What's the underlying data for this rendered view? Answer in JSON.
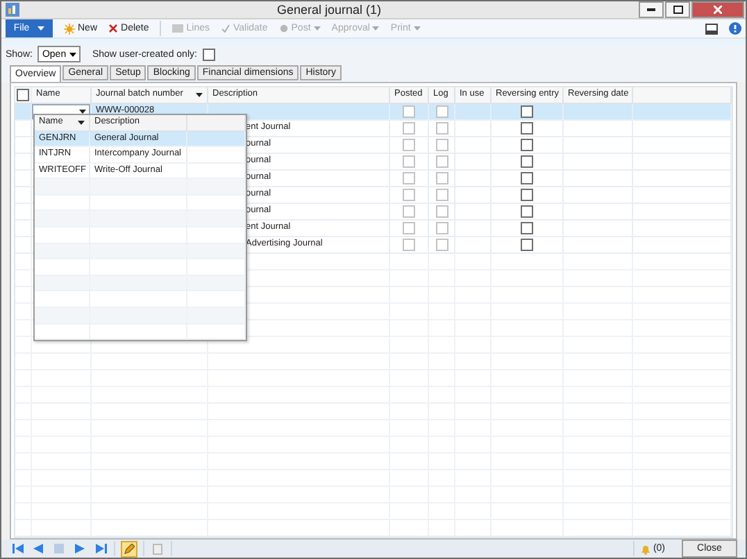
{
  "window": {
    "title": "General journal (1)"
  },
  "toolbar": {
    "file": "File",
    "buttons": [
      {
        "kind": "new",
        "label": "New",
        "disabled": false
      },
      {
        "kind": "delete",
        "label": "Delete",
        "disabled": false
      },
      {
        "kind": "lines",
        "label": "Lines",
        "disabled": true
      },
      {
        "kind": "validate",
        "label": "Validate",
        "disabled": true
      },
      {
        "kind": "post",
        "label": "Post",
        "disabled": true,
        "menu": true
      },
      {
        "kind": "approval",
        "label": "Approval",
        "disabled": true,
        "menu": true
      },
      {
        "kind": "print",
        "label": "Print",
        "disabled": true,
        "menu": true
      }
    ]
  },
  "filter": {
    "show_label": "Show:",
    "show_value": "Open",
    "user_created_label": "Show user-created only:",
    "user_created_checked": false
  },
  "tabs": [
    {
      "label": "Overview",
      "selected": true
    },
    {
      "label": "General",
      "selected": false
    },
    {
      "label": "Setup",
      "selected": false
    },
    {
      "label": "Blocking",
      "selected": false
    },
    {
      "label": "Financial dimensions",
      "selected": false
    },
    {
      "label": "History",
      "selected": false
    }
  ],
  "grid": {
    "select_all_checked": false,
    "columns": [
      "Name",
      "Journal batch number",
      "Description",
      "Posted",
      "Log",
      "In use",
      "Reversing entry",
      "Reversing date"
    ],
    "rows": [
      {
        "selected": true,
        "batch": "WWW-000028",
        "description": "",
        "posted": false,
        "log": false,
        "reversing_entry": false
      },
      {
        "selected": false,
        "description": "ent Journal",
        "posted": false,
        "log": false,
        "reversing_entry": false
      },
      {
        "selected": false,
        "description": "ournal",
        "posted": false,
        "log": false,
        "reversing_entry": false
      },
      {
        "selected": false,
        "description": "ournal",
        "posted": false,
        "log": false,
        "reversing_entry": false
      },
      {
        "selected": false,
        "description": "ournal",
        "posted": false,
        "log": false,
        "reversing_entry": false
      },
      {
        "selected": false,
        "description": "ournal",
        "posted": false,
        "log": false,
        "reversing_entry": false
      },
      {
        "selected": false,
        "description": "ournal",
        "posted": false,
        "log": false,
        "reversing_entry": false
      },
      {
        "selected": false,
        "description": "ent Journal",
        "posted": false,
        "log": false,
        "reversing_entry": false
      },
      {
        "selected": false,
        "description": "Advertising  Journal",
        "posted": false,
        "log": false,
        "reversing_entry": false
      }
    ]
  },
  "lookup": {
    "columns": [
      "Name",
      "Description"
    ],
    "rows": [
      {
        "name": "GENJRN",
        "description": "General Journal",
        "selected": true
      },
      {
        "name": "INTJRN",
        "description": "Intercompany Journal",
        "selected": false
      },
      {
        "name": "WRITEOFF",
        "description": "Write-Off Journal",
        "selected": false
      }
    ]
  },
  "status_bar": {
    "notifications": "(0)",
    "close": "Close"
  }
}
